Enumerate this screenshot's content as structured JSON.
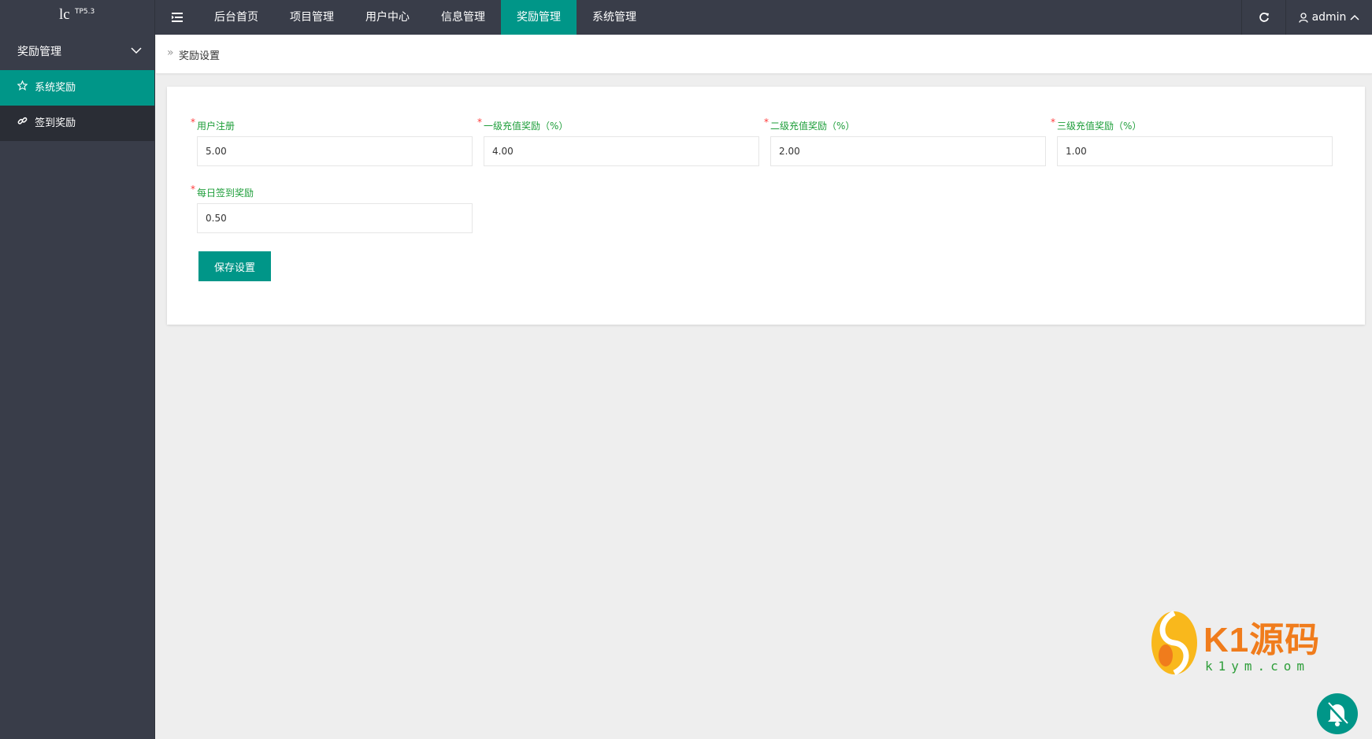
{
  "logo": {
    "main": "lc",
    "sup": "TP5.3"
  },
  "topnav": {
    "items": [
      {
        "label": "后台首页"
      },
      {
        "label": "项目管理"
      },
      {
        "label": "用户中心"
      },
      {
        "label": "信息管理"
      },
      {
        "label": "奖励管理",
        "active": true
      },
      {
        "label": "系统管理"
      }
    ],
    "user": "admin"
  },
  "sidebar": {
    "group": "奖励管理",
    "items": [
      {
        "label": "系统奖励",
        "icon": "star-icon",
        "active": true
      },
      {
        "label": "签到奖励",
        "icon": "link-icon"
      }
    ]
  },
  "breadcrumb": {
    "arrow": "»",
    "current": "奖励设置"
  },
  "form": {
    "required_mark": "*",
    "fields": [
      {
        "label": "用户注册",
        "value": "5.00"
      },
      {
        "label": "一级充值奖励（%）",
        "value": "4.00"
      },
      {
        "label": "二级充值奖励（%）",
        "value": "2.00"
      },
      {
        "label": "三级充值奖励（%）",
        "value": "1.00"
      },
      {
        "label": "每日签到奖励",
        "value": "0.50"
      }
    ],
    "save_label": "保存设置"
  },
  "watermark": {
    "brand": "K1源码",
    "url": "k1ym.com"
  },
  "colors": {
    "accent": "#009688",
    "topbar": "#393d49",
    "label_green": "#1e9e3a",
    "required_red": "#ff3b3b"
  }
}
